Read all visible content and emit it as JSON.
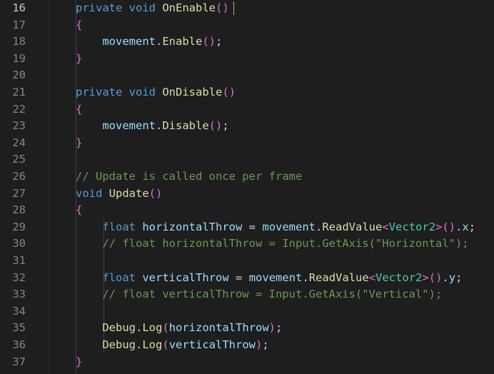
{
  "editor": {
    "lines": [
      {
        "num": "16",
        "text": "private void OnEnable()"
      },
      {
        "num": "17",
        "text": "{"
      },
      {
        "num": "18",
        "text": "movement.Enable();"
      },
      {
        "num": "19",
        "text": "}"
      },
      {
        "num": "20",
        "text": ""
      },
      {
        "num": "21",
        "text": "private void OnDisable()"
      },
      {
        "num": "22",
        "text": "{"
      },
      {
        "num": "23",
        "text": "movement.Disable();"
      },
      {
        "num": "24",
        "text": "}"
      },
      {
        "num": "25",
        "text": ""
      },
      {
        "num": "26",
        "text": "// Update is called once per frame"
      },
      {
        "num": "27",
        "text": "void Update()"
      },
      {
        "num": "28",
        "text": "{"
      },
      {
        "num": "29",
        "text": "float horizontalThrow = movement.ReadValue<Vector2>().x;"
      },
      {
        "num": "30",
        "text": "// float horizontalThrow = Input.GetAxis(\"Horizontal\");"
      },
      {
        "num": "31",
        "text": ""
      },
      {
        "num": "32",
        "text": "float verticalThrow = movement.ReadValue<Vector2>().y;"
      },
      {
        "num": "33",
        "text": "// float verticalThrow = Input.GetAxis(\"Vertical\");"
      },
      {
        "num": "34",
        "text": ""
      },
      {
        "num": "35",
        "text": "Debug.Log(horizontalThrow);"
      },
      {
        "num": "36",
        "text": "Debug.Log(verticalThrow);"
      },
      {
        "num": "37",
        "text": "}"
      }
    ],
    "active_line": "16"
  },
  "theme": {
    "background": "#1e1e1e",
    "keyword": "#569cd6",
    "function": "#dcdcaa",
    "variable": "#9cdcfe",
    "type": "#4ec9b0",
    "comment": "#6a9955",
    "bracket_level1": "#da70d6",
    "bracket_level2": "#ffd700",
    "bracket_level3": "#179fff"
  }
}
